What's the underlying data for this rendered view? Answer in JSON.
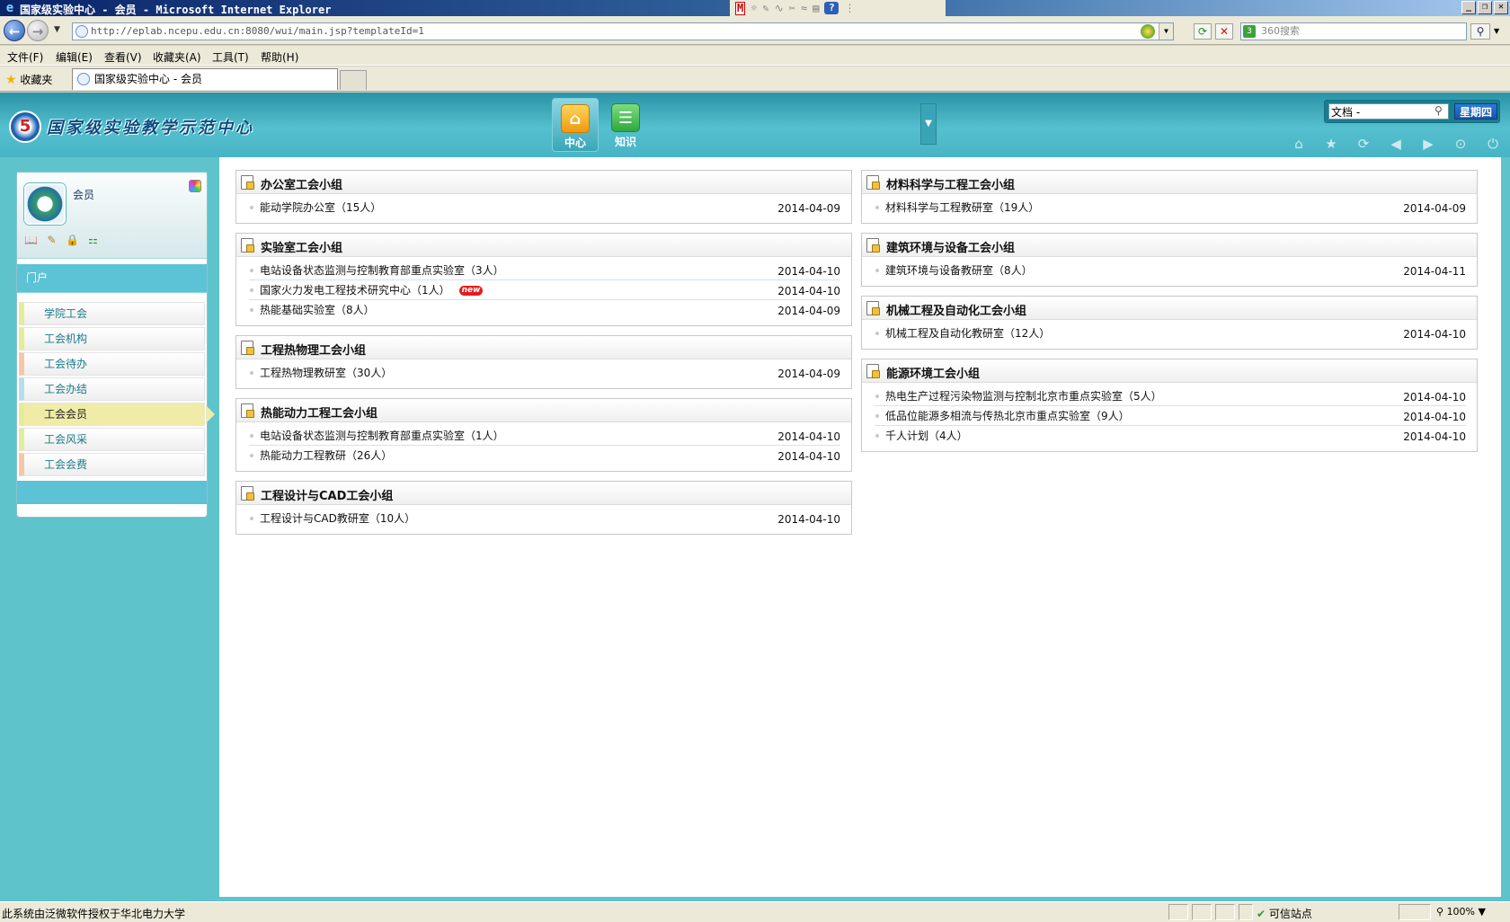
{
  "window": {
    "title": "国家级实验中心 - 会员 - Microsoft Internet Explorer",
    "buttons": [
      "_",
      "❐",
      "✕"
    ]
  },
  "browser": {
    "url": "http://eplab.ncepu.edu.cn:8080/wui/main.jsp?templateId=1",
    "search_placeholder": "360搜索",
    "menu": [
      "文件(F)",
      "编辑(E)",
      "查看(V)",
      "收藏夹(A)",
      "工具(T)",
      "帮助(H)"
    ],
    "favorites_label": "收藏夹",
    "tab_title": "国家级实验中心 - 会员"
  },
  "header": {
    "logo_text": "国家级实验教学示范中心",
    "modules": [
      {
        "label": "中心",
        "icon": "home-icon",
        "active": true
      },
      {
        "label": "知识",
        "icon": "server-icon",
        "active": false
      }
    ],
    "search_value": "文档 -",
    "day_label": "星期四",
    "tool_icons": [
      "home-icon",
      "star-icon",
      "refresh-icon",
      "back-icon",
      "forward-icon",
      "collapse-icon",
      "power-icon"
    ]
  },
  "sidebar": {
    "user_name": "会员",
    "section_title": "门户",
    "items": [
      {
        "label": "学院工会",
        "accent": "c1"
      },
      {
        "label": "工会机构",
        "accent": "c1"
      },
      {
        "label": "工会待办",
        "accent": "c2"
      },
      {
        "label": "工会办结",
        "accent": "c3"
      },
      {
        "label": "工会会员",
        "accent": "c1",
        "active": true
      },
      {
        "label": "工会风采",
        "accent": "c1"
      },
      {
        "label": "工会会费",
        "accent": "c2"
      }
    ]
  },
  "panels_left": [
    {
      "title": "办公室工会小组",
      "rows": [
        {
          "text": "能动学院办公室（15人）",
          "date": "2014-04-09"
        }
      ]
    },
    {
      "title": "实验室工会小组",
      "rows": [
        {
          "text": "电站设备状态监测与控制教育部重点实验室（3人）",
          "date": "2014-04-10"
        },
        {
          "text": "国家火力发电工程技术研究中心（1人）",
          "date": "2014-04-10",
          "badge": "new"
        },
        {
          "text": "热能基础实验室（8人）",
          "date": "2014-04-09"
        }
      ]
    },
    {
      "title": "工程热物理工会小组",
      "rows": [
        {
          "text": "工程热物理教研室（30人）",
          "date": "2014-04-09"
        }
      ]
    },
    {
      "title": "热能动力工程工会小组",
      "rows": [
        {
          "text": "电站设备状态监测与控制教育部重点实验室（1人）",
          "date": "2014-04-10"
        },
        {
          "text": "热能动力工程教研（26人）",
          "date": "2014-04-10"
        }
      ]
    },
    {
      "title": "工程设计与CAD工会小组",
      "rows": [
        {
          "text": "工程设计与CAD教研室（10人）",
          "date": "2014-04-10"
        }
      ]
    }
  ],
  "panels_right": [
    {
      "title": "材料科学与工程工会小组",
      "rows": [
        {
          "text": "材料科学与工程教研室（19人）",
          "date": "2014-04-09"
        }
      ]
    },
    {
      "title": "建筑环境与设备工会小组",
      "rows": [
        {
          "text": "建筑环境与设备教研室（8人）",
          "date": "2014-04-11"
        }
      ]
    },
    {
      "title": "机械工程及自动化工会小组",
      "rows": [
        {
          "text": "机械工程及自动化教研室（12人）",
          "date": "2014-04-10"
        }
      ]
    },
    {
      "title": "能源环境工会小组",
      "rows": [
        {
          "text": "热电生产过程污染物监测与控制北京市重点实验室（5人）",
          "date": "2014-04-10"
        },
        {
          "text": "低品位能源多相流与传热北京市重点实验室（9人）",
          "date": "2014-04-10"
        },
        {
          "text": "千人计划（4人）",
          "date": "2014-04-10"
        }
      ]
    }
  ],
  "statusbar": {
    "text": "此系统由泛微软件授权于华北电力大学",
    "zone": "可信站点",
    "zoom": "100%"
  }
}
